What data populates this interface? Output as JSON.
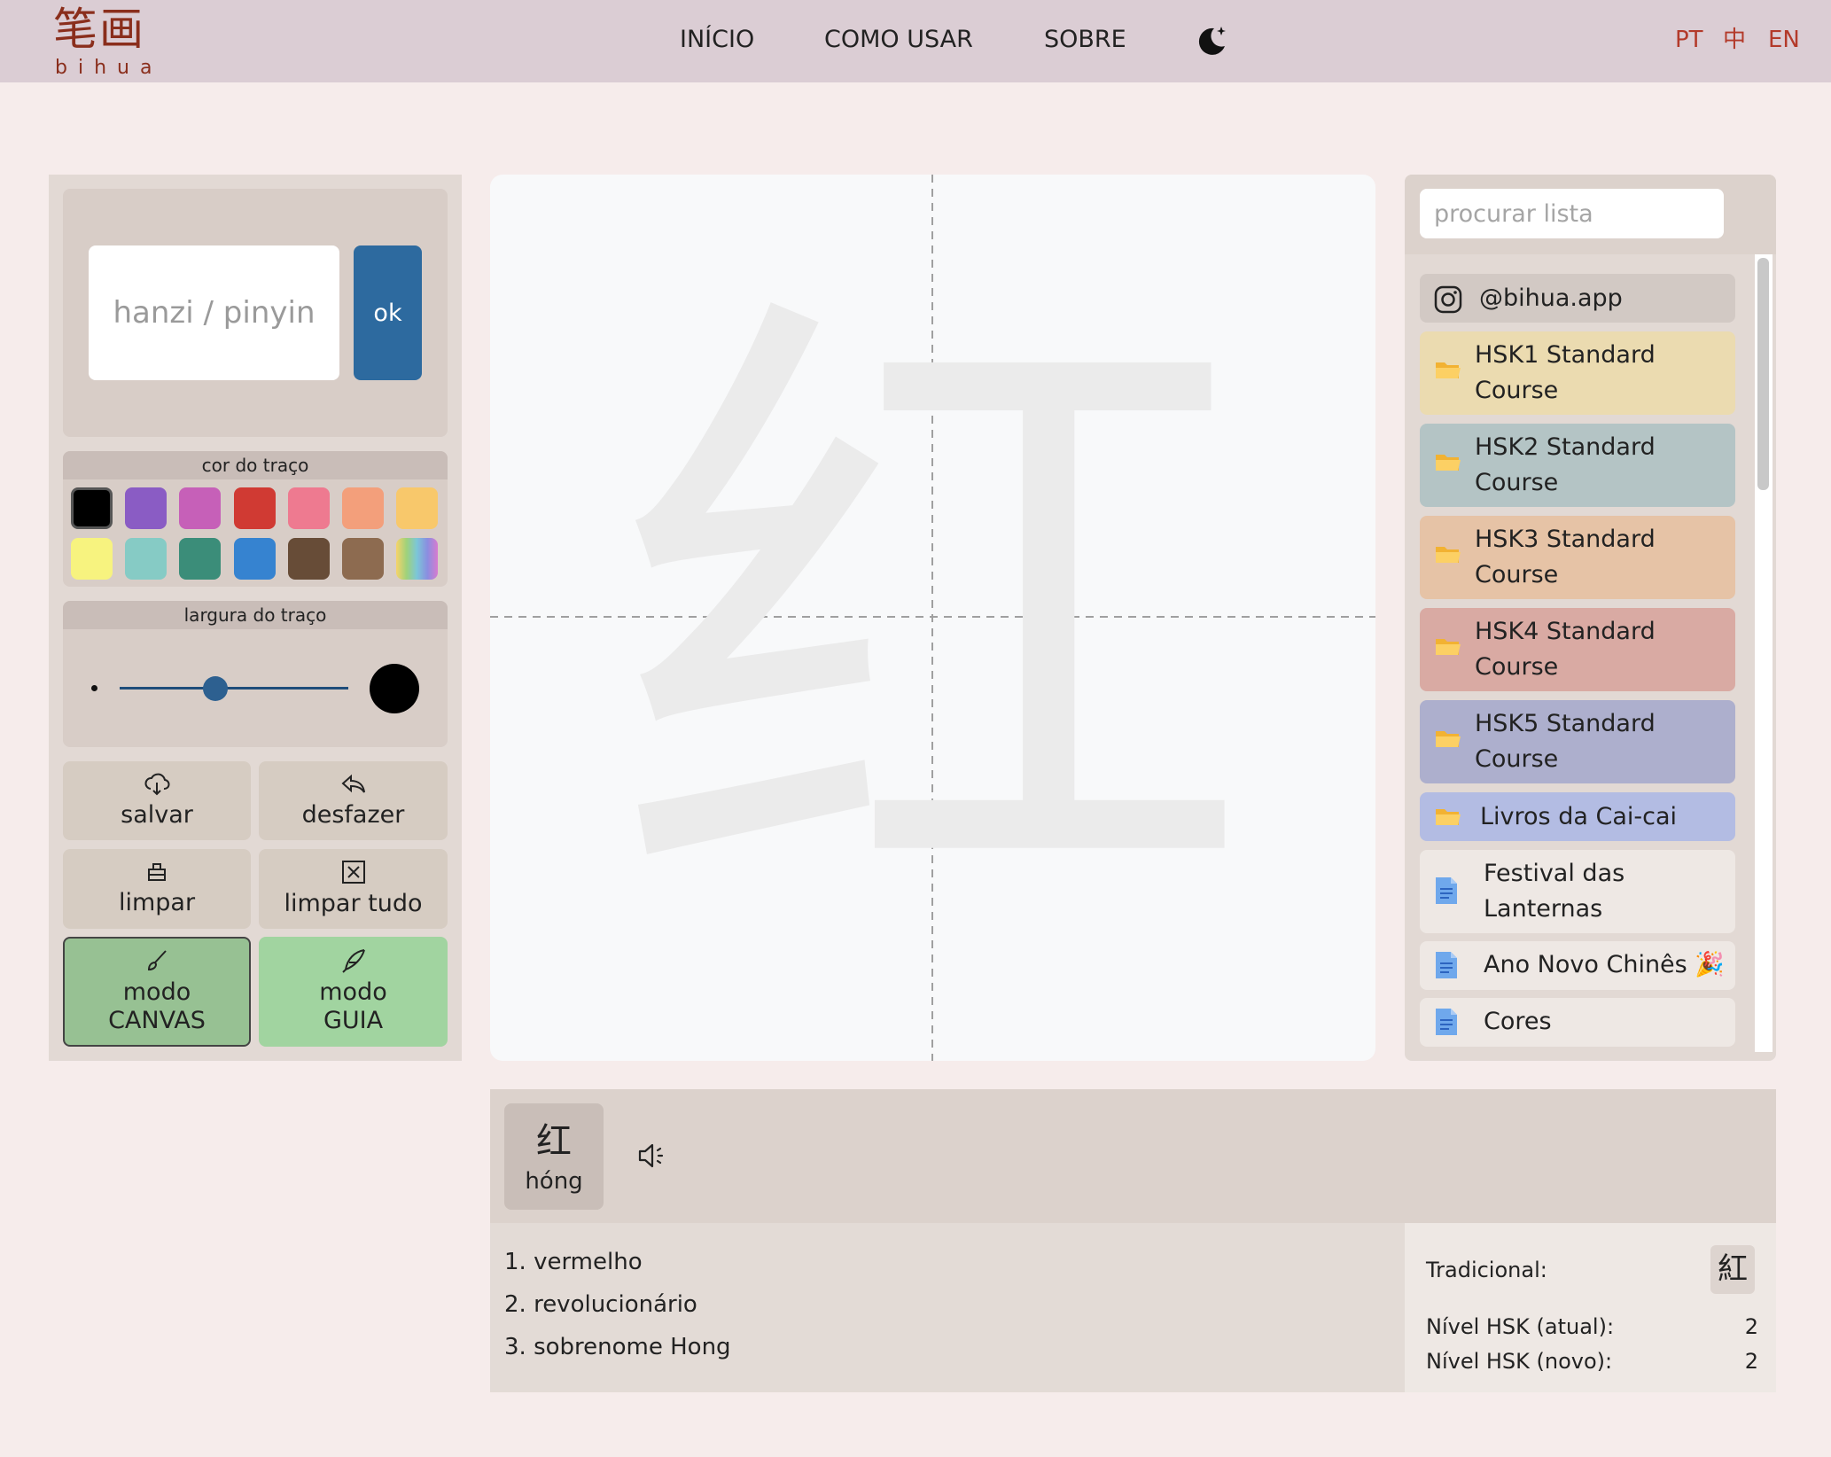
{
  "header": {
    "logo_chars": "笔画",
    "logo_text": "bihua",
    "nav": [
      "INÍCIO",
      "COMO USAR",
      "SOBRE"
    ],
    "langs": [
      "PT",
      "中",
      "EN"
    ]
  },
  "search_box": {
    "placeholder": "hanzi / pinyin",
    "ok_label": "ok"
  },
  "stroke_color": {
    "title": "cor do traço",
    "swatches": [
      "#000000",
      "#8a5cc4",
      "#c660b8",
      "#d03a33",
      "#ee7a90",
      "#f39f7b",
      "#f8c86b",
      "#f7f37f",
      "#86cbc5",
      "#3b8d79",
      "#3683d0",
      "#674c37",
      "#8d6b50",
      "rainbow"
    ]
  },
  "stroke_width": {
    "title": "largura do traço",
    "level": 0.42
  },
  "buttons": {
    "save": "salvar",
    "undo": "desfazer",
    "clear": "limpar",
    "clear_all": "limpar tudo",
    "mode_canvas_1": "modo",
    "mode_canvas_2": "CANVAS",
    "mode_guide_1": "modo",
    "mode_guide_2": "GUIA"
  },
  "canvas": {
    "character": "红"
  },
  "list_search": {
    "placeholder": "procurar lista"
  },
  "list": [
    {
      "label": "@bihua.app",
      "icon": "instagram-icon"
    },
    {
      "label_1": "HSK1 Standard",
      "label_2": "Course",
      "icon": "folder-icon"
    },
    {
      "label_1": "HSK2 Standard",
      "label_2": "Course",
      "icon": "folder-icon"
    },
    {
      "label_1": "HSK3 Standard",
      "label_2": "Course",
      "icon": "folder-icon"
    },
    {
      "label_1": "HSK4 Standard",
      "label_2": "Course",
      "icon": "folder-icon"
    },
    {
      "label_1": "HSK5 Standard",
      "label_2": "Course",
      "icon": "folder-icon"
    },
    {
      "label": "Livros da Cai-cai",
      "icon": "folder-icon"
    },
    {
      "label_1": "Festival das",
      "label_2": "Lanternas",
      "icon": "document-icon"
    },
    {
      "label": "Ano Novo Chinês 🎉",
      "icon": "document-icon"
    },
    {
      "label": "Cores",
      "icon": "document-icon"
    }
  ],
  "word": {
    "char": "红",
    "pinyin": "hóng",
    "definitions": [
      "1. vermelho",
      "2. revolucionário",
      "3. sobrenome Hong"
    ],
    "traditional_label": "Tradicional:",
    "traditional": "紅",
    "hsk_current_label": "Nível HSK (atual):",
    "hsk_current": "2",
    "hsk_new_label": "Nível HSK (novo):",
    "hsk_new": "2"
  },
  "colors": {
    "accent": "#2d6a9f",
    "canvas_mode": "#97c193",
    "guide_mode": "#a1d4a0"
  }
}
